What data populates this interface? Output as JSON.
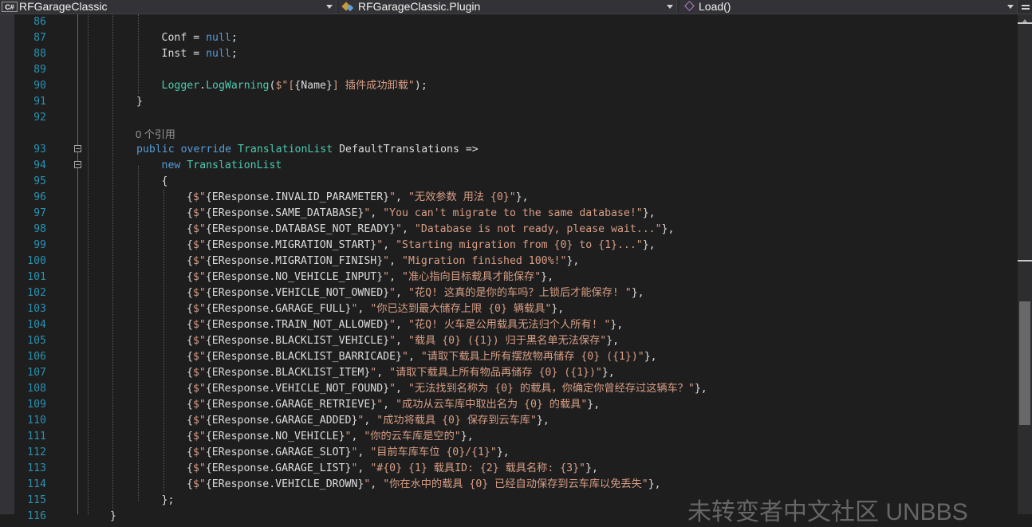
{
  "navbar": {
    "project_dropdown": {
      "icon": "csharp-file-icon",
      "label": "RFGarageClassic"
    },
    "type_dropdown": {
      "icon": "project-icon",
      "label": "RFGarageClassic.Plugin"
    },
    "member_dropdown": {
      "icon": "method-icon",
      "label": "Load()"
    }
  },
  "code_lens": {
    "references_label": "0 个引用"
  },
  "lines": [
    {
      "n": "86",
      "tokens": []
    },
    {
      "n": "87",
      "tokens": [
        [
          "pl",
          "Conf = "
        ],
        [
          "kw",
          "null"
        ],
        [
          "pl",
          ";"
        ]
      ]
    },
    {
      "n": "88",
      "tokens": [
        [
          "pl",
          "Inst = "
        ],
        [
          "kw",
          "null"
        ],
        [
          "pl",
          ";"
        ]
      ]
    },
    {
      "n": "89",
      "tokens": []
    },
    {
      "n": "90",
      "tokens": [
        [
          "cl",
          "Logger"
        ],
        [
          "pl",
          "."
        ],
        [
          "cl",
          "LogWarning"
        ],
        [
          "pl",
          "("
        ],
        [
          "st",
          "$\"["
        ],
        [
          "pl",
          "{Name}"
        ],
        [
          "st",
          "] 插件成功卸载\""
        ],
        [
          "pl",
          ");"
        ]
      ]
    },
    {
      "n": "91",
      "tokens": [
        [
          "pl",
          "}"
        ]
      ]
    },
    {
      "n": "92",
      "tokens": []
    },
    {
      "n": "93",
      "tokens": [
        [
          "kw",
          "public override "
        ],
        [
          "ty",
          "TranslationList"
        ],
        [
          "pl",
          " DefaultTranslations =>"
        ]
      ]
    },
    {
      "n": "94",
      "tokens": [
        [
          "kw",
          "new "
        ],
        [
          "ty",
          "TranslationList"
        ]
      ]
    },
    {
      "n": "95",
      "tokens": [
        [
          "pl",
          "{"
        ]
      ]
    },
    {
      "n": "96",
      "tokens": [
        [
          "pl",
          "{"
        ],
        [
          "st",
          "$\""
        ],
        [
          "pl",
          "{EResponse.INVALID_PARAMETER}"
        ],
        [
          "st",
          "\""
        ],
        [
          "pl",
          ", "
        ],
        [
          "st",
          "\"无效参数 用法 {0}\""
        ],
        [
          "pl",
          "},"
        ]
      ]
    },
    {
      "n": "97",
      "tokens": [
        [
          "pl",
          "{"
        ],
        [
          "st",
          "$\""
        ],
        [
          "pl",
          "{EResponse.SAME_DATABASE}"
        ],
        [
          "st",
          "\""
        ],
        [
          "pl",
          ", "
        ],
        [
          "st",
          "\"You can't migrate to the same database!\""
        ],
        [
          "pl",
          "},"
        ]
      ]
    },
    {
      "n": "98",
      "tokens": [
        [
          "pl",
          "{"
        ],
        [
          "st",
          "$\""
        ],
        [
          "pl",
          "{EResponse.DATABASE_NOT_READY}"
        ],
        [
          "st",
          "\""
        ],
        [
          "pl",
          ", "
        ],
        [
          "st",
          "\"Database is not ready, please wait...\""
        ],
        [
          "pl",
          "},"
        ]
      ]
    },
    {
      "n": "99",
      "tokens": [
        [
          "pl",
          "{"
        ],
        [
          "st",
          "$\""
        ],
        [
          "pl",
          "{EResponse.MIGRATION_START}"
        ],
        [
          "st",
          "\""
        ],
        [
          "pl",
          ", "
        ],
        [
          "st",
          "\"Starting migration from {0} to {1}...\""
        ],
        [
          "pl",
          "},"
        ]
      ]
    },
    {
      "n": "100",
      "tokens": [
        [
          "pl",
          "{"
        ],
        [
          "st",
          "$\""
        ],
        [
          "pl",
          "{EResponse.MIGRATION_FINISH}"
        ],
        [
          "st",
          "\""
        ],
        [
          "pl",
          ", "
        ],
        [
          "st",
          "\"Migration finished 100%!\""
        ],
        [
          "pl",
          "},"
        ]
      ]
    },
    {
      "n": "101",
      "tokens": [
        [
          "pl",
          "{"
        ],
        [
          "st",
          "$\""
        ],
        [
          "pl",
          "{EResponse.NO_VEHICLE_INPUT}"
        ],
        [
          "st",
          "\""
        ],
        [
          "pl",
          ", "
        ],
        [
          "st",
          "\"准心指向目标载具才能保存\""
        ],
        [
          "pl",
          "},"
        ]
      ]
    },
    {
      "n": "102",
      "tokens": [
        [
          "pl",
          "{"
        ],
        [
          "st",
          "$\""
        ],
        [
          "pl",
          "{EResponse.VEHICLE_NOT_OWNED}"
        ],
        [
          "st",
          "\""
        ],
        [
          "pl",
          ", "
        ],
        [
          "st",
          "\"花Q! 这真的是你的车吗？上锁后才能保存! \""
        ],
        [
          "pl",
          "},"
        ]
      ]
    },
    {
      "n": "103",
      "tokens": [
        [
          "pl",
          "{"
        ],
        [
          "st",
          "$\""
        ],
        [
          "pl",
          "{EResponse.GARAGE_FULL}"
        ],
        [
          "st",
          "\""
        ],
        [
          "pl",
          ", "
        ],
        [
          "st",
          "\"你已达到最大储存上限 {0} 辆载具\""
        ],
        [
          "pl",
          "},"
        ]
      ]
    },
    {
      "n": "104",
      "tokens": [
        [
          "pl",
          "{"
        ],
        [
          "st",
          "$\""
        ],
        [
          "pl",
          "{EResponse.TRAIN_NOT_ALLOWED}"
        ],
        [
          "st",
          "\""
        ],
        [
          "pl",
          ", "
        ],
        [
          "st",
          "\"花Q! 火车是公用载具无法归个人所有! \""
        ],
        [
          "pl",
          "},"
        ]
      ]
    },
    {
      "n": "105",
      "tokens": [
        [
          "pl",
          "{"
        ],
        [
          "st",
          "$\""
        ],
        [
          "pl",
          "{EResponse.BLACKLIST_VEHICLE}"
        ],
        [
          "st",
          "\""
        ],
        [
          "pl",
          ", "
        ],
        [
          "st",
          "\"载具 {0} ({1}) 归于黑名单无法保存\""
        ],
        [
          "pl",
          "},"
        ]
      ]
    },
    {
      "n": "106",
      "tokens": [
        [
          "pl",
          "{"
        ],
        [
          "st",
          "$\""
        ],
        [
          "pl",
          "{EResponse.BLACKLIST_BARRICADE}"
        ],
        [
          "st",
          "\""
        ],
        [
          "pl",
          ", "
        ],
        [
          "st",
          "\"请取下载具上所有摆放物再储存 {0} ({1})\""
        ],
        [
          "pl",
          "},"
        ]
      ]
    },
    {
      "n": "107",
      "tokens": [
        [
          "pl",
          "{"
        ],
        [
          "st",
          "$\""
        ],
        [
          "pl",
          "{EResponse.BLACKLIST_ITEM}"
        ],
        [
          "st",
          "\""
        ],
        [
          "pl",
          ", "
        ],
        [
          "st",
          "\"请取下载具上所有物品再储存 {0} ({1})\""
        ],
        [
          "pl",
          "},"
        ]
      ]
    },
    {
      "n": "108",
      "tokens": [
        [
          "pl",
          "{"
        ],
        [
          "st",
          "$\""
        ],
        [
          "pl",
          "{EResponse.VEHICLE_NOT_FOUND}"
        ],
        [
          "st",
          "\""
        ],
        [
          "pl",
          ", "
        ],
        [
          "st",
          "\"无法找到名称为 {0} 的载具，你确定你曾经存过这辆车？\""
        ],
        [
          "pl",
          "},"
        ]
      ]
    },
    {
      "n": "109",
      "tokens": [
        [
          "pl",
          "{"
        ],
        [
          "st",
          "$\""
        ],
        [
          "pl",
          "{EResponse.GARAGE_RETRIEVE}"
        ],
        [
          "st",
          "\""
        ],
        [
          "pl",
          ", "
        ],
        [
          "st",
          "\"成功从云车库中取出名为 {0} 的载具\""
        ],
        [
          "pl",
          "},"
        ]
      ]
    },
    {
      "n": "110",
      "tokens": [
        [
          "pl",
          "{"
        ],
        [
          "st",
          "$\""
        ],
        [
          "pl",
          "{EResponse.GARAGE_ADDED}"
        ],
        [
          "st",
          "\""
        ],
        [
          "pl",
          ", "
        ],
        [
          "st",
          "\"成功将载具 {0} 保存到云车库\""
        ],
        [
          "pl",
          "},"
        ]
      ]
    },
    {
      "n": "111",
      "tokens": [
        [
          "pl",
          "{"
        ],
        [
          "st",
          "$\""
        ],
        [
          "pl",
          "{EResponse.NO_VEHICLE}"
        ],
        [
          "st",
          "\""
        ],
        [
          "pl",
          ", "
        ],
        [
          "st",
          "\"你的云车库是空的\""
        ],
        [
          "pl",
          "},"
        ]
      ]
    },
    {
      "n": "112",
      "tokens": [
        [
          "pl",
          "{"
        ],
        [
          "st",
          "$\""
        ],
        [
          "pl",
          "{EResponse.GARAGE_SLOT}"
        ],
        [
          "st",
          "\""
        ],
        [
          "pl",
          ", "
        ],
        [
          "st",
          "\"目前车库车位 {0}/{1}\""
        ],
        [
          "pl",
          "},"
        ]
      ]
    },
    {
      "n": "113",
      "tokens": [
        [
          "pl",
          "{"
        ],
        [
          "st",
          "$\""
        ],
        [
          "pl",
          "{EResponse.GARAGE_LIST}"
        ],
        [
          "st",
          "\""
        ],
        [
          "pl",
          ", "
        ],
        [
          "st",
          "\"#{0} {1} 载具ID: {2} 载具名称: {3}\""
        ],
        [
          "pl",
          "},"
        ]
      ]
    },
    {
      "n": "114",
      "tokens": [
        [
          "pl",
          "{"
        ],
        [
          "st",
          "$\""
        ],
        [
          "pl",
          "{EResponse.VEHICLE_DROWN}"
        ],
        [
          "st",
          "\""
        ],
        [
          "pl",
          ", "
        ],
        [
          "st",
          "\"你在水中的载具 {0} 已经自动保存到云车库以免丢失\""
        ],
        [
          "pl",
          "},"
        ]
      ]
    },
    {
      "n": "115",
      "tokens": [
        [
          "pl",
          "};"
        ]
      ]
    },
    {
      "n": "116",
      "tokens": [
        [
          "pl",
          "}"
        ]
      ]
    }
  ],
  "watermark": "未转变者中文社区 UNBBS"
}
